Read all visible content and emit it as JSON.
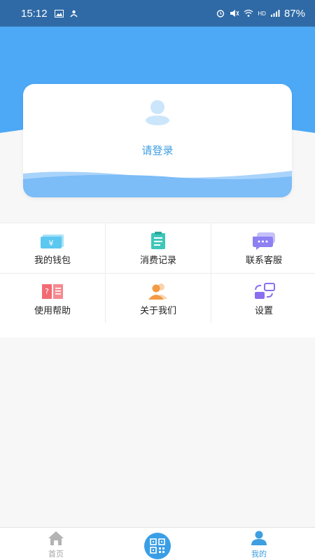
{
  "status_bar": {
    "time": "15:12",
    "battery": "87%",
    "network": "HD"
  },
  "profile_card": {
    "login_prompt": "请登录"
  },
  "menu": [
    {
      "label": "我的钱包",
      "icon": "wallet-icon",
      "color": "#5cc7f0"
    },
    {
      "label": "消费记录",
      "icon": "clipboard-icon",
      "color": "#3ec7b9"
    },
    {
      "label": "联系客服",
      "icon": "chat-bubble-icon",
      "color": "#8c80f2"
    },
    {
      "label": "使用帮助",
      "icon": "help-book-icon",
      "color": "#f26b73"
    },
    {
      "label": "关于我们",
      "icon": "people-icon",
      "color": "#f39a45"
    },
    {
      "label": "设置",
      "icon": "settings-switch-icon",
      "color": "#8b6ef0"
    }
  ],
  "tabs": [
    {
      "label": "首页",
      "icon": "home-icon",
      "active": false
    },
    {
      "label": "我的",
      "icon": "user-icon",
      "active": true
    }
  ],
  "colors": {
    "status_bar": "#2f6aa6",
    "hero_blue": "#4da8f6",
    "accent": "#3d9ee0",
    "tab_inactive": "#a5a5a5"
  }
}
